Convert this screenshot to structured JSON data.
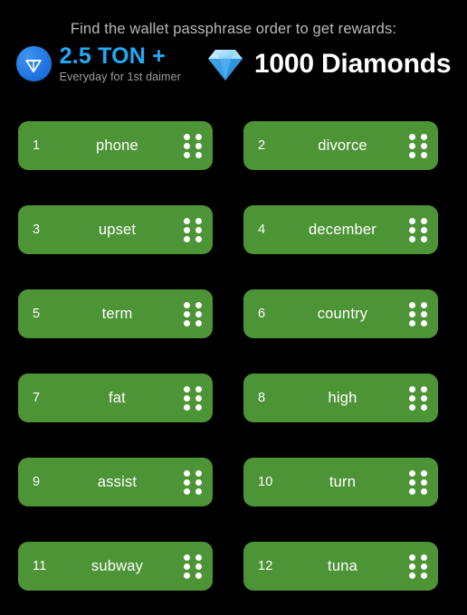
{
  "header": {
    "headline": "Find the wallet passphrase order to get rewards:",
    "rewards": [
      {
        "icon": "ton-coin-icon",
        "amount": "2.5 TON +",
        "sub": "Everyday for 1st daimer",
        "color": "#22aaf5"
      },
      {
        "icon": "gem-stone-icon",
        "amount": "1000 Diamonds",
        "color": "#ffffff"
      }
    ]
  },
  "colors": {
    "background": "#000000",
    "chip": "#4d9437",
    "ton_blue": "#22aaf5",
    "headline": "#b9b9b9",
    "subtext": "#9d9d9d"
  },
  "word_list": [
    {
      "index": "1",
      "word": "phone"
    },
    {
      "index": "2",
      "word": "divorce"
    },
    {
      "index": "3",
      "word": "upset"
    },
    {
      "index": "4",
      "word": "december"
    },
    {
      "index": "5",
      "word": "term"
    },
    {
      "index": "6",
      "word": "country"
    },
    {
      "index": "7",
      "word": "fat"
    },
    {
      "index": "8",
      "word": "high"
    },
    {
      "index": "9",
      "word": "assist"
    },
    {
      "index": "10",
      "word": "turn"
    },
    {
      "index": "11",
      "word": "subway"
    },
    {
      "index": "12",
      "word": "tuna"
    }
  ],
  "handle": {
    "icon": "drag-handle-icon",
    "dot_count": 6
  }
}
